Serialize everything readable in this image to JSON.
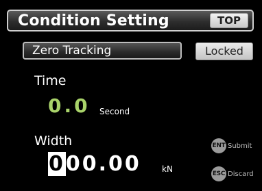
{
  "header": {
    "title": "Condition Setting",
    "top_button": "TOP"
  },
  "zero_tracking": {
    "label": "Zero Tracking",
    "state": "Locked"
  },
  "time": {
    "label": "Time",
    "value": "0.0",
    "unit": "Second"
  },
  "width": {
    "label": "Width",
    "value_cursor_digit": "0",
    "value_rest": "00.00",
    "unit": "kN"
  },
  "keys": {
    "ent": {
      "badge": "ENT",
      "label": "Submit"
    },
    "esc": {
      "badge": "ESC",
      "label": "Discard"
    }
  },
  "colors": {
    "background": "#000000",
    "time_value": "#a9d36a",
    "key_badge": "#9b9b9b"
  }
}
